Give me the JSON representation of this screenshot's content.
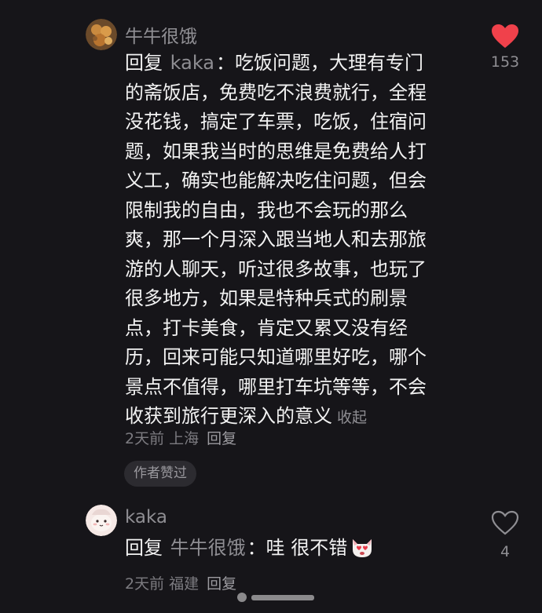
{
  "comments": [
    {
      "username": "牛牛很饿",
      "reply_prefix": "回复",
      "reply_target": "kaka",
      "reply_colon": "：",
      "lines": [
        "吃饭问题，大理有专门",
        "的斋饭店，免费吃不浪费就行，全程",
        "没花钱，搞定了车票，吃饭，住宿问",
        "题，如果我当时的思维是免费给人打",
        "义工，确实也能解决吃住问题，但会",
        "限制我的自由，我也不会玩的那么",
        "爽，那一个月深入跟当地人和去那旅",
        "游的人聊天，听过很多故事，也玩了",
        "很多地方，如果是特种兵式的刷景",
        "点，打卡美食，肯定又累又没有经",
        "历，回来可能只知道哪里好吃，哪个",
        "景点不值得，哪里打车坑等等，不会",
        "收获到旅行更深入的意义"
      ],
      "collapse_label": "收起",
      "time": "2天前",
      "location": "上海",
      "reply_label": "回复",
      "author_badge": "作者赞过",
      "like_count": "153",
      "liked": true,
      "like_color": "#f0414b",
      "avatar_icon": "food-avatar-icon"
    },
    {
      "username": "kaka",
      "reply_prefix": "回复",
      "reply_target": "牛牛很饿",
      "reply_colon": "：",
      "text": "哇 很不错",
      "emoji_icon": "heart-eyes-cat-icon",
      "time": "2天前",
      "location": "福建",
      "reply_label": "回复",
      "like_count": "4",
      "liked": false,
      "avatar_icon": "cartoon-avatar-icon"
    }
  ]
}
